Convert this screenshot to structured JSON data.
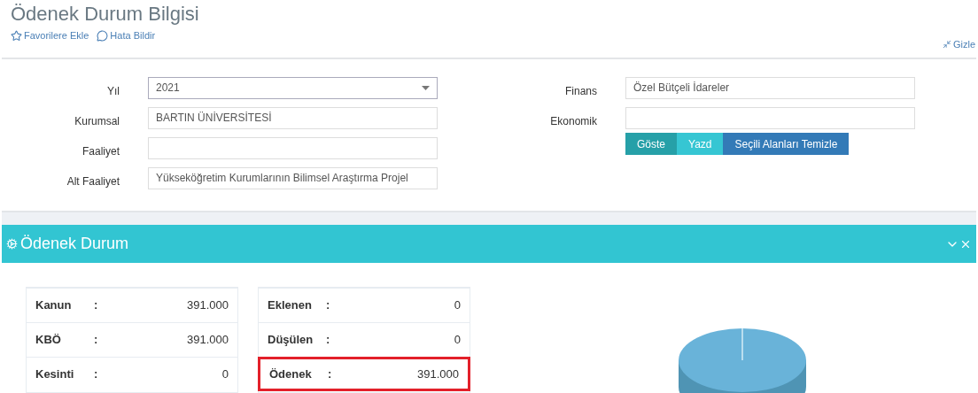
{
  "page": {
    "title": "Ödenek Durum Bilgisi",
    "links": [
      {
        "kind": "favorite",
        "label": "Favorilere Ekle"
      },
      {
        "kind": "report",
        "label": "Hata Bildir"
      }
    ],
    "hide_link": "Gizle"
  },
  "filters_left": [
    {
      "label": "Yıl",
      "kind": "select",
      "value": "2021"
    },
    {
      "label": "Kurumsal",
      "kind": "text",
      "value": "BARTIN ÜNİVERSİTESİ"
    },
    {
      "label": "Faaliyet",
      "kind": "text"
    },
    {
      "label": "Alt Faaliyet",
      "kind": "text",
      "value": "Yükseköğretim Kurumlarının Bilimsel Araştırma Projel"
    }
  ],
  "filters_right": [
    {
      "label": "Finans",
      "kind": "text",
      "value": "Özel Bütçeli İdareler"
    },
    {
      "label": "Ekonomik",
      "kind": "text"
    }
  ],
  "buttons": [
    {
      "label": "Göste",
      "color": "#26a0a8"
    },
    {
      "label": "Yazd",
      "color": "#36c6d3"
    },
    {
      "label": "Seçili Alanları Temizle",
      "color": "#337ab7"
    }
  ],
  "panel": {
    "title": "Ödenek Durum",
    "tables": [
      {
        "rows": [
          {
            "label": "Kanun",
            "separator": ":",
            "value": "391.000",
            "highlighted": false
          },
          {
            "label": "KBÖ",
            "separator": ":",
            "value": "391.000",
            "highlighted": false
          },
          {
            "label": "Kesinti",
            "separator": ":",
            "value": "0",
            "highlighted": false
          }
        ]
      },
      {
        "rows": [
          {
            "label": "Eklenen",
            "separator": ":",
            "value": "0",
            "highlighted": false
          },
          {
            "label": "Düşülen",
            "separator": ":",
            "value": "0",
            "highlighted": false
          },
          {
            "label": "Ödenek",
            "separator": ":",
            "value": "391.000",
            "highlighted": true
          }
        ]
      }
    ]
  }
}
